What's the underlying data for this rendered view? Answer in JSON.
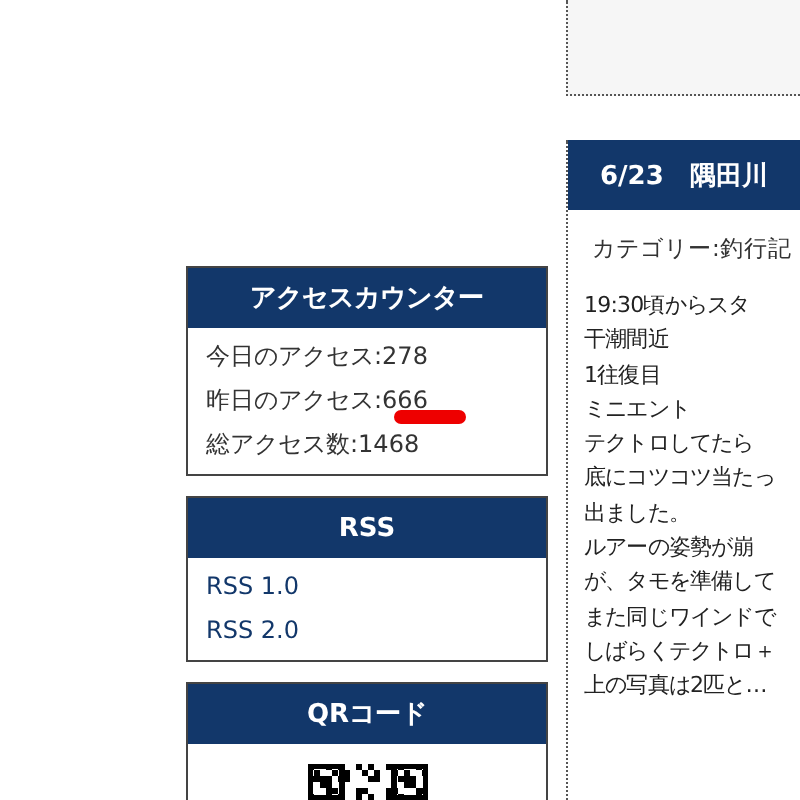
{
  "sidebar": [
    {
      "kind": "counter",
      "title": "アクセスカウンター",
      "lines": [
        {
          "text": "今日のアクセス:278",
          "marked": false
        },
        {
          "text": "昨日のアクセス:666",
          "marked": true
        },
        {
          "text": "総アクセス数:1468",
          "marked": false
        }
      ]
    },
    {
      "kind": "links",
      "title": "RSS",
      "links": [
        "RSS 1.0",
        "RSS 2.0"
      ]
    },
    {
      "kind": "qr",
      "title": "QRコード"
    }
  ],
  "post": {
    "title": "6/23　隅田川",
    "category": "カテゴリー:釣行記",
    "lines": [
      "19:30頃からスタ",
      "干潮間近",
      "1往復目",
      "ミニエント",
      "テクトロしてたら",
      "底にコツコツ当たっ",
      "出ました。",
      "ルアーの姿勢が崩",
      "が、タモを準備して",
      "また同じワインドで",
      "しばらくテクトロ＋",
      "上の写真は2匹と…"
    ]
  }
}
